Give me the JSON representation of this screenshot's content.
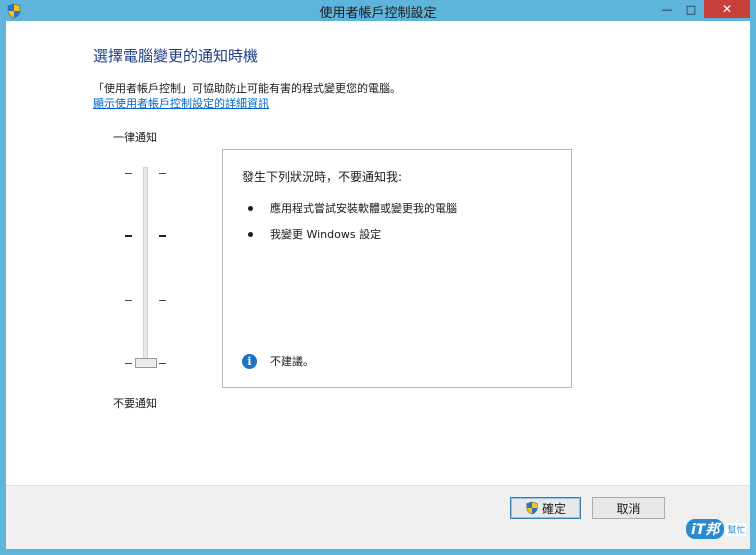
{
  "window": {
    "title": "使用者帳戶控制設定",
    "controls": {
      "minimize": "—",
      "maximize": "□",
      "close": "✕"
    }
  },
  "main": {
    "heading": "選擇電腦變更的通知時機",
    "description": "「使用者帳戶控制」可協助防止可能有害的程式變更您的電腦。",
    "link": "顯示使用者帳戶控制設定的詳細資訊"
  },
  "slider": {
    "top_label": "一律通知",
    "bottom_label": "不要通知",
    "levels": 4,
    "selected_level": 1
  },
  "panel": {
    "title": "發生下列狀況時，不要通知我:",
    "items": [
      "應用程式嘗試安裝軟體或變更我的電腦",
      "我變更 Windows 設定"
    ],
    "info_text": "不建議。"
  },
  "footer": {
    "ok_label": "確定",
    "cancel_label": "取消"
  },
  "watermark": {
    "brand": "iT邦",
    "sub": "幫忙"
  },
  "icons": {
    "title": "uac-shield-icon",
    "info": "info-icon",
    "ok": "uac-shield-icon"
  },
  "colors": {
    "frame": "#5fb4db",
    "heading": "#1e3e87",
    "link": "#0066cc",
    "close": "#c7403a",
    "info": "#1f6fc6"
  }
}
